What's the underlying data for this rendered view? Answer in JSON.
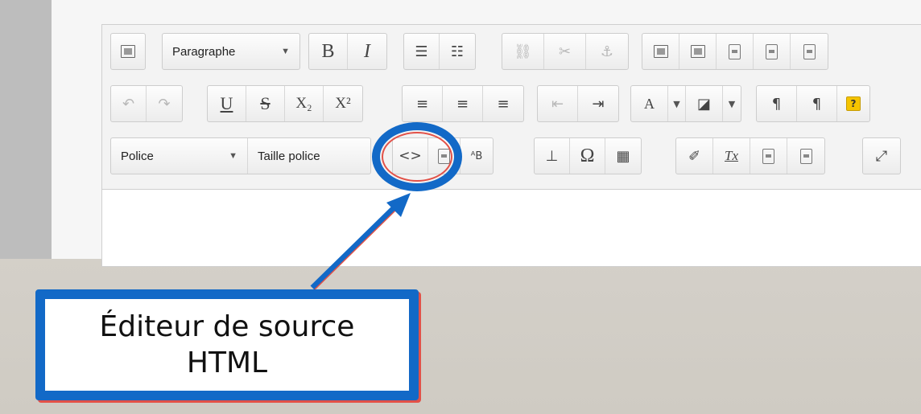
{
  "toolbar": {
    "row1": {
      "paragraph_combo": "Paragraphe",
      "bold": "B",
      "italic": "I"
    },
    "row2": {
      "underline": "U",
      "strike": "S",
      "subscript": "X₂",
      "superscript": "X²",
      "help": "?"
    },
    "row3": {
      "font_combo": "Police",
      "size_combo": "Taille police",
      "source_button": "<>",
      "omega": "Ω",
      "clear_format": "Tx"
    }
  },
  "callout": {
    "line1": "Éditeur de source",
    "line2": "HTML"
  },
  "colors": {
    "highlight": "#1269c7",
    "accent_red": "#e25148"
  }
}
